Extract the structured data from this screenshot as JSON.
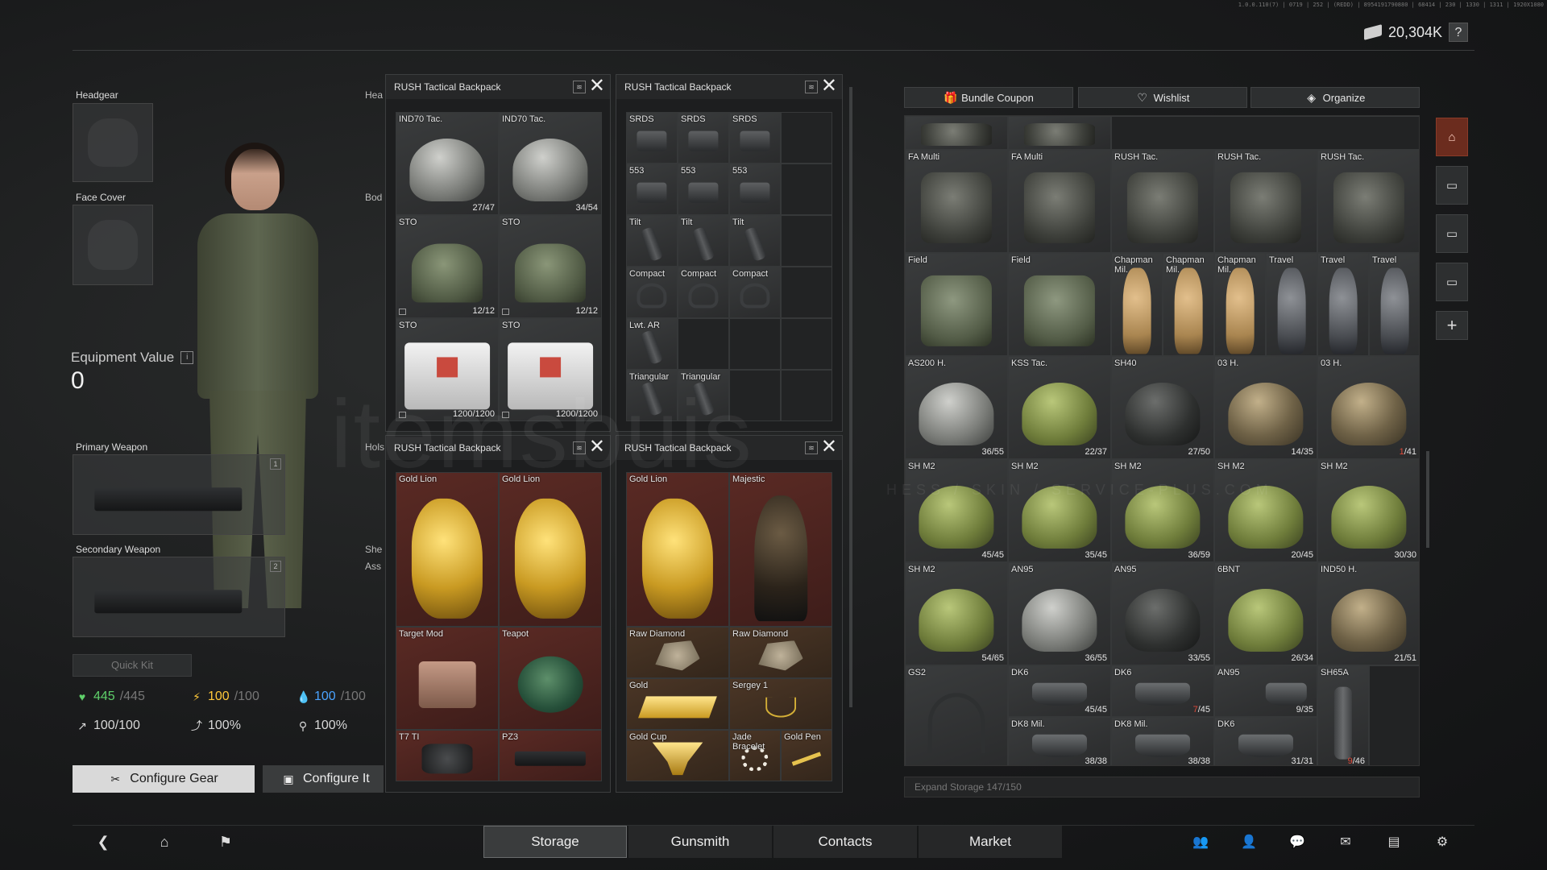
{
  "build_string": "1.0.0.110(7) | 0719 | 252 | (REDD) | 8954191790880 | 68414 | 230 | 1330 | 1311 | 1920X1080",
  "currency": {
    "amount": "20,304K",
    "help": "?"
  },
  "gear": {
    "headgear": "Headgear",
    "face_cover": "Face Cover",
    "equipment_value_label": "Equipment Value",
    "equipment_value_info": "i",
    "equipment_value": "0",
    "primary_weapon": "Primary Weapon",
    "primary_slot": "1",
    "secondary_weapon": "Secondary Weapon",
    "secondary_slot": "2",
    "quick_kit": "Quick Kit",
    "behind_labels": [
      "Hea",
      "Bod",
      "Hols",
      "She",
      "Ass"
    ]
  },
  "stats": {
    "health": "445",
    "health_max": "/445",
    "energy": "100",
    "energy_max": "/100",
    "hydration": "100",
    "hydration_max": "/100",
    "stamina": "100/100",
    "stat2": "100%",
    "stat3": "100%"
  },
  "buttons": {
    "configure_gear": "Configure Gear",
    "configure_items": "Configure It"
  },
  "containers": [
    {
      "title": "RUSH Tactical Backpack",
      "items": [
        {
          "name": "IND70 Tac.",
          "count": "27/47",
          "art": "helm"
        },
        {
          "name": "IND70 Tac.",
          "count": "34/54",
          "art": "helm"
        },
        {
          "name": "STO",
          "count": "12/12",
          "art": "medbag"
        },
        {
          "name": "STO",
          "count": "12/12",
          "art": "medbag"
        },
        {
          "name": "STO",
          "count": "1200/1200",
          "art": "medbox"
        },
        {
          "name": "STO",
          "count": "1200/1200",
          "art": "medbox"
        }
      ]
    },
    {
      "title": "RUSH Tactical Backpack",
      "items": [
        "SRDS",
        "SRDS",
        "SRDS",
        "553",
        "553",
        "553",
        "Tilt",
        "Tilt",
        "Tilt",
        "Compact",
        "Compact",
        "Compact",
        "Lwt. AR",
        "Triangular",
        "Triangular"
      ]
    },
    {
      "title": "RUSH Tactical Backpack",
      "items": [
        {
          "name": "Gold Lion"
        },
        {
          "name": "Gold Lion"
        },
        {
          "name": "Target Mod"
        },
        {
          "name": "Teapot"
        },
        {
          "name": "T7 TI"
        },
        {
          "name": "PZ3"
        }
      ]
    },
    {
      "title": "RUSH Tactical Backpack",
      "items": [
        {
          "name": "Gold Lion"
        },
        {
          "name": "Majestic"
        },
        {
          "name": "Raw Diamond"
        },
        {
          "name": "Raw Diamond"
        },
        {
          "name": "Gold"
        },
        {
          "name": "Sergey 1"
        },
        {
          "name": "Gold Cup"
        },
        {
          "name": "Jade Bracelet"
        },
        {
          "name": "Gold Pen"
        }
      ]
    }
  ],
  "stash": {
    "buttons": [
      "Bundle Coupon",
      "Wishlist",
      "Organize"
    ],
    "rows": [
      {
        "items": [
          {
            "name": "FA Multi",
            "art": "bag"
          },
          {
            "name": "FA Multi",
            "art": "bag"
          },
          {
            "name": "RUSH Tac.",
            "art": "bag"
          },
          {
            "name": "RUSH Tac.",
            "art": "bag"
          },
          {
            "name": "RUSH Tac.",
            "art": "bag"
          }
        ]
      },
      {
        "items": [
          {
            "name": "Field",
            "art": "bag field"
          },
          {
            "name": "Field",
            "art": "bag field"
          },
          {
            "name": "Chapman Mil.",
            "art": "bag tan"
          },
          {
            "name": "Chapman Mil.",
            "art": "bag tan"
          },
          {
            "name": "Chapman Mil.",
            "art": "bag tan"
          },
          {
            "name": "Travel",
            "art": "bag gray"
          },
          {
            "name": "Travel",
            "art": "bag gray"
          },
          {
            "name": "Travel",
            "art": "bag gray"
          }
        ]
      },
      {
        "items": [
          {
            "name": "AS200 H.",
            "count": "36/55",
            "art": "helm"
          },
          {
            "name": "KSS Tac.",
            "count": "22/37",
            "art": "helm green"
          },
          {
            "name": "SH40",
            "count": "27/50",
            "art": "helm dark"
          },
          {
            "name": "03 H.",
            "count": "14/35",
            "art": "helm camo"
          },
          {
            "name": "03 H.",
            "count_red": "1",
            "count_rest": "/41",
            "art": "helm camo"
          }
        ]
      },
      {
        "items": [
          {
            "name": "SH M2",
            "count": "45/45",
            "art": "helm green"
          },
          {
            "name": "SH M2",
            "count": "35/45",
            "art": "helm green"
          },
          {
            "name": "SH M2",
            "count": "36/59",
            "art": "helm green"
          },
          {
            "name": "SH M2",
            "count": "20/45",
            "art": "helm green"
          },
          {
            "name": "SH M2",
            "count": "30/30",
            "art": "helm green"
          }
        ]
      },
      {
        "items": [
          {
            "name": "SH M2",
            "count": "54/65",
            "art": "helm green"
          },
          {
            "name": "AN95",
            "count": "36/55",
            "art": "helm"
          },
          {
            "name": "AN95",
            "count": "33/55",
            "art": "helm dark"
          },
          {
            "name": "6BNT",
            "count": "26/34",
            "art": "helm green"
          },
          {
            "name": "IND50 H.",
            "count": "21/51",
            "art": "helm camo"
          }
        ]
      },
      {
        "items": [
          {
            "name": "GS2",
            "art": "headset"
          },
          {
            "name": "DK6",
            "count": "45/45",
            "art": "visor"
          },
          {
            "name": "DK6",
            "count_red": "7",
            "count_rest": "/45",
            "art": "visor"
          },
          {
            "name": "AN95",
            "count": "9/35",
            "art": "visor"
          },
          {
            "name": "SH65A",
            "count_red": "9",
            "count_rest": "/46",
            "art": "plate"
          },
          {
            "name": "DK8 Mil.",
            "count": "38/38",
            "art": "visor"
          },
          {
            "name": "DK8 Mil.",
            "count": "38/38",
            "art": "visor"
          },
          {
            "name": "DK6",
            "count": "31/31",
            "art": "visor"
          }
        ]
      }
    ],
    "expand_label": "Expand Storage",
    "expand_count": "147/150"
  },
  "side_tabs": [
    "house-icon",
    "box-icon",
    "box-icon",
    "box-icon",
    "+"
  ],
  "nav": {
    "tabs": [
      "Storage",
      "Gunsmith",
      "Contacts",
      "Market"
    ],
    "active": "Storage"
  },
  "watermark": "itemsbuis",
  "watermark_sub": "HESS / SKIN / SERVICE-PLUS.COM",
  "colors": {
    "accent": "#6b2c1e",
    "health": "#5fd06a",
    "energy": "#ffc83a",
    "hydration": "#4aa3ff",
    "red_count": "#e04a3a"
  }
}
